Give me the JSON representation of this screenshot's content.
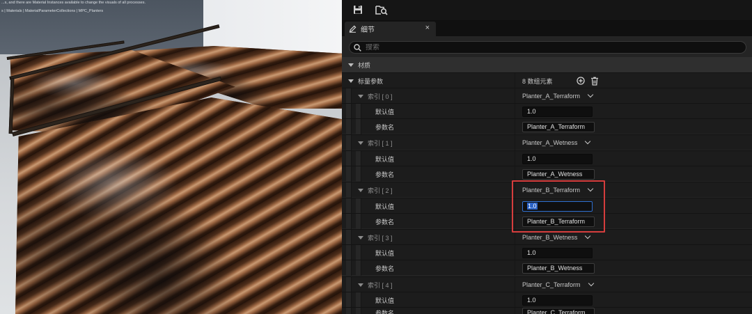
{
  "viewport": {
    "wall_line_1": "...s, and there are Material Instances available to change the visuals of all processes.",
    "breadcrumb": "s | Materials | MaterialParameterCollections | MPC_Planters"
  },
  "toolbar": {
    "save_icon": "save-icon",
    "browse_icon": "browse-folder-icon"
  },
  "tab": {
    "label": "细节",
    "close": "×"
  },
  "search": {
    "placeholder": "搜索"
  },
  "tree": {
    "material_category": "材质",
    "scalar_params_label": "标量参数",
    "scalar_params_count": "8 数组元素",
    "default_label": "默认值",
    "param_name_label": "参数名",
    "items": [
      {
        "index": "索引 [ 0 ]",
        "name": "Planter_A_Terraform",
        "default": "1.0"
      },
      {
        "index": "索引 [ 1 ]",
        "name": "Planter_A_Wetness",
        "default": "1.0"
      },
      {
        "index": "索引 [ 2 ]",
        "name": "Planter_B_Terraform",
        "default": "1.0"
      },
      {
        "index": "索引 [ 3 ]",
        "name": "Planter_B_Wetness",
        "default": "1.0"
      },
      {
        "index": "索引 [ 4 ]",
        "name": "Planter_C_Terraform",
        "default": "1.0"
      }
    ]
  },
  "colors": {
    "panel_bg": "#242424",
    "highlight": "#d63d3d",
    "focus": "#2e6fd0"
  }
}
